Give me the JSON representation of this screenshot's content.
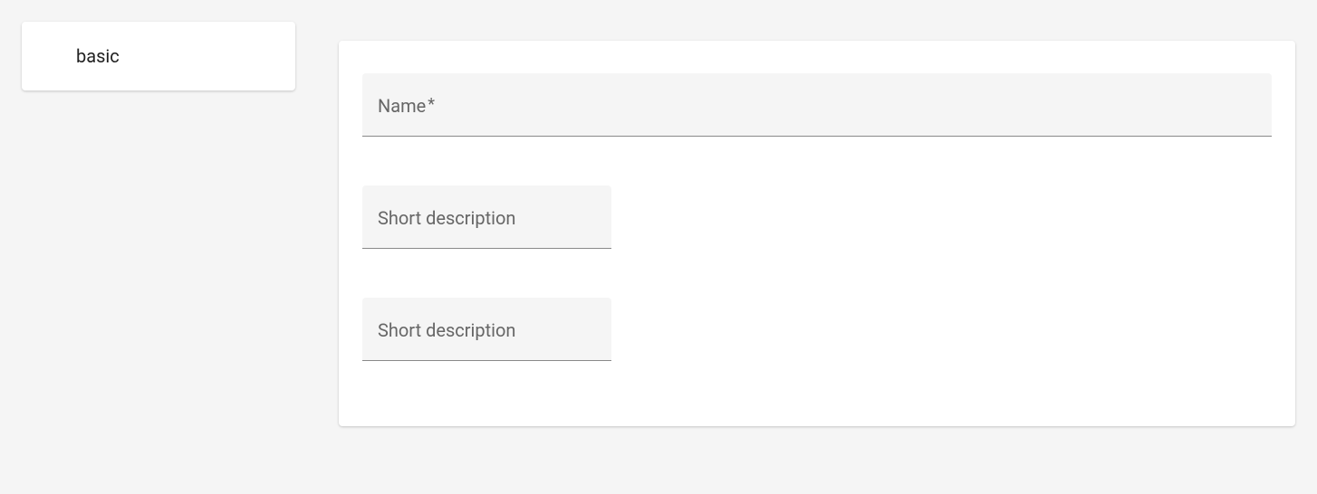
{
  "sidebar": {
    "items": [
      {
        "label": "basic"
      }
    ]
  },
  "form": {
    "fields": [
      {
        "label": "Name",
        "required": true,
        "value": "",
        "width": "full"
      },
      {
        "label": "Short description",
        "required": false,
        "value": "",
        "width": "short"
      },
      {
        "label": "Short description",
        "required": false,
        "value": "",
        "width": "short"
      }
    ],
    "required_marker": "*"
  }
}
